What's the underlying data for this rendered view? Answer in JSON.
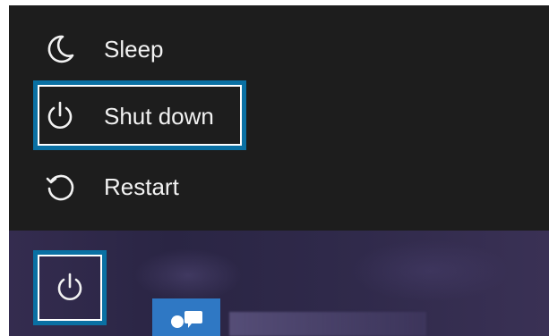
{
  "power_menu": {
    "items": [
      {
        "label": "Sleep",
        "icon": "moon-icon"
      },
      {
        "label": "Shut down",
        "icon": "power-icon"
      },
      {
        "label": "Restart",
        "icon": "restart-icon"
      }
    ]
  },
  "start": {
    "power_button_icon": "power-icon",
    "tile_icon": "people-icon"
  },
  "colors": {
    "menu_bg": "#1d1d1d",
    "highlight": "#0a70a3",
    "taskbar": "#2f2a4a",
    "tile": "#2f78c4"
  }
}
